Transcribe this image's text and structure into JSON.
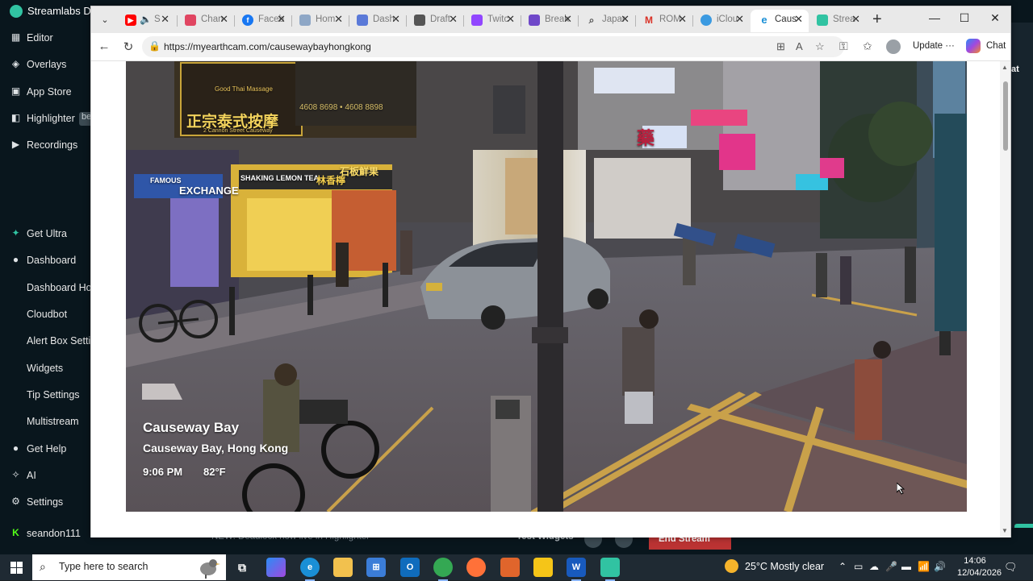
{
  "streamlabs": {
    "title": "Streamlabs De",
    "sidebar": [
      {
        "label": "Editor",
        "icon": "grid-icon"
      },
      {
        "label": "Overlays",
        "icon": "overlays-icon"
      },
      {
        "label": "App Store",
        "icon": "store-icon"
      },
      {
        "label": "Highlighter",
        "icon": "highlighter-icon",
        "badge": "be"
      },
      {
        "label": "Recordings",
        "icon": "play-icon"
      },
      {
        "label": "Get Ultra",
        "icon": "ultra-icon"
      },
      {
        "label": "Dashboard",
        "icon": "dashboard-icon"
      },
      {
        "label": "Dashboard Hor"
      },
      {
        "label": "Cloudbot"
      },
      {
        "label": "Alert Box Settin"
      },
      {
        "label": "Widgets"
      },
      {
        "label": "Tip Settings"
      },
      {
        "label": "Multistream"
      },
      {
        "label": "Get Help",
        "icon": "help-icon"
      },
      {
        "label": "AI",
        "icon": "ai-icon"
      },
      {
        "label": "Settings",
        "icon": "gear-icon"
      },
      {
        "label": "seandon111",
        "icon": "kick-icon"
      }
    ],
    "right_clip": "at",
    "bottom": {
      "news": "NEW: Deadlock now live in Highlighter",
      "test_widgets": "Test Widgets",
      "end_stream": "End Stream"
    }
  },
  "browser": {
    "tabs": [
      {
        "label": "S",
        "favicon": "youtube-icon",
        "color": "#ff0000",
        "mute": true
      },
      {
        "label": "Chan",
        "favicon": "channel-icon",
        "color": "#e04561"
      },
      {
        "label": "Faceb",
        "favicon": "facebook-icon",
        "color": "#1877f2"
      },
      {
        "label": "Hom",
        "favicon": "home-icon",
        "color": "#8ea7c6"
      },
      {
        "label": "Dash",
        "favicon": "dashboard-icon",
        "color": "#5a79d8"
      },
      {
        "label": "Draft",
        "favicon": "draft-icon",
        "color": "#555555"
      },
      {
        "label": "Twitc",
        "favicon": "twitch-icon",
        "color": "#9146ff"
      },
      {
        "label": "Break",
        "favicon": "break-icon",
        "color": "#6f48c9"
      },
      {
        "label": "Japar",
        "favicon": "search-icon",
        "color": "#888888"
      },
      {
        "label": "ROM",
        "favicon": "gmail-icon",
        "color": "#d93025"
      },
      {
        "label": "iClou",
        "favicon": "icloud-icon",
        "color": "#3b9ae1"
      },
      {
        "label": "Caus",
        "favicon": "edge-icon",
        "color": "#1a8fd6",
        "active": true
      },
      {
        "label": "Strea",
        "favicon": "streamlabs-icon",
        "color": "#31c3a2"
      }
    ],
    "url": "https://myearthcam.com/causewaybayhongkong",
    "update_label": "Update",
    "chat_label": "Chat"
  },
  "webcam": {
    "location_title": "Causeway Bay",
    "location_sub": "Causeway Bay, Hong Kong",
    "time": "9:06 PM",
    "temperature": "82°F",
    "signs": {
      "thai_massage": "Good Thai Massage",
      "thai_chinese": "正宗泰式按摩",
      "thai_street": "2 Cannon Street Causeway",
      "phone": "4608 8698 • 4608 8898",
      "exchange_top": "FAMOUS",
      "exchange": "EXCHANGE",
      "lemon_tea": "SHAKING LEMON TEA",
      "lemon_chinese": "林香檸",
      "fresh": "石板鮮果",
      "pharmacy": "藥"
    }
  },
  "taskbar": {
    "search_placeholder": "Type here to search",
    "weather": "25°C  Mostly clear",
    "time": "14:06",
    "date": "12/04/2026"
  }
}
